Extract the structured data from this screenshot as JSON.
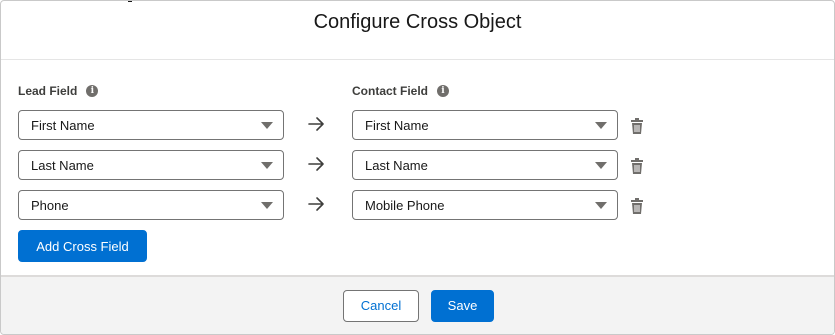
{
  "modal": {
    "title": "Configure Cross Object"
  },
  "labels": {
    "lead_field": "Lead Field",
    "contact_field": "Contact Field"
  },
  "mappings": [
    {
      "lead": "First Name",
      "contact": "First Name"
    },
    {
      "lead": "Last Name",
      "contact": "Last Name"
    },
    {
      "lead": "Phone",
      "contact": "Mobile Phone"
    }
  ],
  "actions": {
    "add_cross_field": "Add Cross Field",
    "cancel": "Cancel",
    "save": "Save"
  },
  "icons": {
    "info": "info-icon",
    "arrow": "arrow-right-icon",
    "delete": "trash-icon",
    "dropdown": "chevron-down-icon"
  },
  "colors": {
    "brand": "#0070d2",
    "footer_bg": "#f3f3f3",
    "icon_gray": "#706e6b"
  }
}
